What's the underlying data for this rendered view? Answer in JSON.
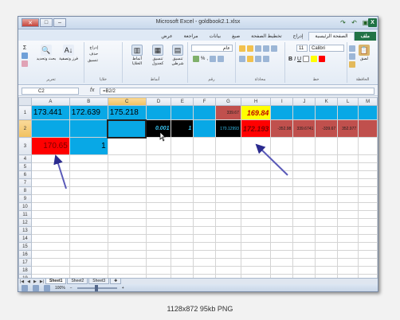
{
  "window": {
    "title": "Microsoft Excel - goldbook2.1.xlsx"
  },
  "caption": "1128x872 95kb PNG",
  "quick_access": {
    "save_icon": "save-icon",
    "undo_icon": "undo-icon",
    "redo_icon": "redo-icon"
  },
  "tabs": [
    {
      "label": "ملف"
    },
    {
      "label": "الصفحة الرئيسية"
    },
    {
      "label": "إدراج"
    },
    {
      "label": "تخطيط الصفحة"
    },
    {
      "label": "صيغ"
    },
    {
      "label": "بيانات"
    },
    {
      "label": "مراجعة"
    },
    {
      "label": "عرض"
    }
  ],
  "ribbon": {
    "paste_label": "لصق",
    "clipboard_label": "الحافظة",
    "font_name": "Calibri",
    "font_size": "11",
    "font_label": "خط",
    "alignment_label": "محاذاة",
    "number_format": "عام",
    "number_label": "رقم",
    "conditional_label": "تنسيق شرطي",
    "format_table_label": "تنسيق كجدول",
    "cell_styles_label": "أنماط الخلايا",
    "styles_label": "أنماط",
    "insert_label": "إدراج",
    "delete_label": "حذف",
    "format_label": "تنسيق",
    "cells_label": "خلايا",
    "sort_label": "فرز وتصفية",
    "find_label": "بحث وتحديد",
    "editing_label": "تحرير"
  },
  "formula_bar": {
    "name_box": "C2",
    "fx": "fx",
    "formula": "=B2/2"
  },
  "columns": [
    "A",
    "B",
    "C",
    "D",
    "E",
    "F",
    "G",
    "H",
    "I",
    "J",
    "K",
    "L",
    "M"
  ],
  "rows": [
    "1",
    "2",
    "3",
    "4",
    "5",
    "6",
    "7",
    "8",
    "9",
    "10",
    "11",
    "12",
    "13",
    "14",
    "15",
    "16",
    "17",
    "18",
    "19",
    "20",
    "21",
    "22",
    "23"
  ],
  "cells": {
    "A1": "173.441",
    "B1": "172.639",
    "C1": "175.218",
    "G1": "339.67",
    "H1": "169.84",
    "D2": "0.001",
    "E2": "1",
    "G2": "170.12993",
    "H2": "172.193",
    "I2": "-352.98",
    "J2": "339.6741",
    "K2": "-339.67",
    "L2": "352.977",
    "A3": "170.65",
    "B3": "1"
  },
  "sheets": [
    {
      "label": "Sheet1"
    },
    {
      "label": "Sheet2"
    },
    {
      "label": "Sheet3"
    }
  ],
  "status": {
    "zoom": "100%"
  }
}
